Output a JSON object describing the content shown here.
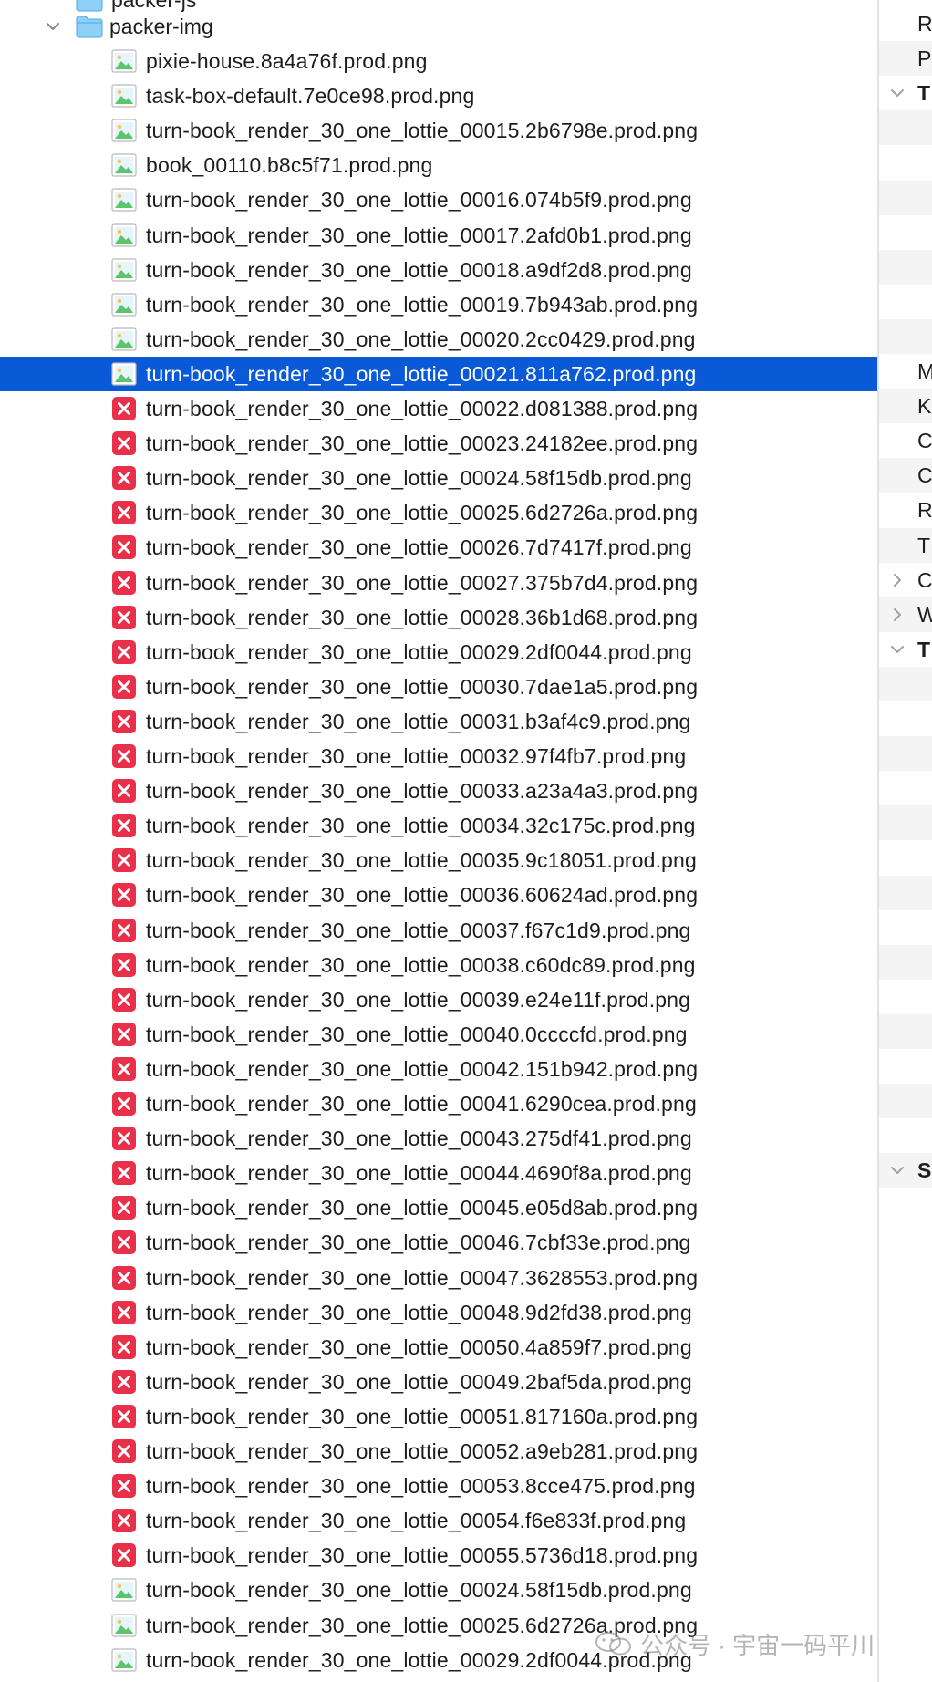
{
  "tree": {
    "parent_label_partial": "packer-js",
    "folder": {
      "name": "packer-img",
      "expanded": true,
      "icon": "folder-icon"
    },
    "selected_index": 9,
    "files": [
      {
        "name": "pixie-house.8a4a76f.prod.png",
        "icon": "image-file-icon"
      },
      {
        "name": "task-box-default.7e0ce98.prod.png",
        "icon": "image-file-icon"
      },
      {
        "name": "turn-book_render_30_one_lottie_00015.2b6798e.prod.png",
        "icon": "image-file-icon"
      },
      {
        "name": "book_00110.b8c5f71.prod.png",
        "icon": "image-file-icon"
      },
      {
        "name": "turn-book_render_30_one_lottie_00016.074b5f9.prod.png",
        "icon": "image-file-icon"
      },
      {
        "name": "turn-book_render_30_one_lottie_00017.2afd0b1.prod.png",
        "icon": "image-file-icon"
      },
      {
        "name": "turn-book_render_30_one_lottie_00018.a9df2d8.prod.png",
        "icon": "image-file-icon"
      },
      {
        "name": "turn-book_render_30_one_lottie_00019.7b943ab.prod.png",
        "icon": "image-file-icon"
      },
      {
        "name": "turn-book_render_30_one_lottie_00020.2cc0429.prod.png",
        "icon": "image-file-icon"
      },
      {
        "name": "turn-book_render_30_one_lottie_00021.811a762.prod.png",
        "icon": "image-file-icon"
      },
      {
        "name": "turn-book_render_30_one_lottie_00022.d081388.prod.png",
        "icon": "missing-file-icon"
      },
      {
        "name": "turn-book_render_30_one_lottie_00023.24182ee.prod.png",
        "icon": "missing-file-icon"
      },
      {
        "name": "turn-book_render_30_one_lottie_00024.58f15db.prod.png",
        "icon": "missing-file-icon"
      },
      {
        "name": "turn-book_render_30_one_lottie_00025.6d2726a.prod.png",
        "icon": "missing-file-icon"
      },
      {
        "name": "turn-book_render_30_one_lottie_00026.7d7417f.prod.png",
        "icon": "missing-file-icon"
      },
      {
        "name": "turn-book_render_30_one_lottie_00027.375b7d4.prod.png",
        "icon": "missing-file-icon"
      },
      {
        "name": "turn-book_render_30_one_lottie_00028.36b1d68.prod.png",
        "icon": "missing-file-icon"
      },
      {
        "name": "turn-book_render_30_one_lottie_00029.2df0044.prod.png",
        "icon": "missing-file-icon"
      },
      {
        "name": "turn-book_render_30_one_lottie_00030.7dae1a5.prod.png",
        "icon": "missing-file-icon"
      },
      {
        "name": "turn-book_render_30_one_lottie_00031.b3af4c9.prod.png",
        "icon": "missing-file-icon"
      },
      {
        "name": "turn-book_render_30_one_lottie_00032.97f4fb7.prod.png",
        "icon": "missing-file-icon"
      },
      {
        "name": "turn-book_render_30_one_lottie_00033.a23a4a3.prod.png",
        "icon": "missing-file-icon"
      },
      {
        "name": "turn-book_render_30_one_lottie_00034.32c175c.prod.png",
        "icon": "missing-file-icon"
      },
      {
        "name": "turn-book_render_30_one_lottie_00035.9c18051.prod.png",
        "icon": "missing-file-icon"
      },
      {
        "name": "turn-book_render_30_one_lottie_00036.60624ad.prod.png",
        "icon": "missing-file-icon"
      },
      {
        "name": "turn-book_render_30_one_lottie_00037.f67c1d9.prod.png",
        "icon": "missing-file-icon"
      },
      {
        "name": "turn-book_render_30_one_lottie_00038.c60dc89.prod.png",
        "icon": "missing-file-icon"
      },
      {
        "name": "turn-book_render_30_one_lottie_00039.e24e11f.prod.png",
        "icon": "missing-file-icon"
      },
      {
        "name": "turn-book_render_30_one_lottie_00040.0ccccfd.prod.png",
        "icon": "missing-file-icon"
      },
      {
        "name": "turn-book_render_30_one_lottie_00042.151b942.prod.png",
        "icon": "missing-file-icon"
      },
      {
        "name": "turn-book_render_30_one_lottie_00041.6290cea.prod.png",
        "icon": "missing-file-icon"
      },
      {
        "name": "turn-book_render_30_one_lottie_00043.275df41.prod.png",
        "icon": "missing-file-icon"
      },
      {
        "name": "turn-book_render_30_one_lottie_00044.4690f8a.prod.png",
        "icon": "missing-file-icon"
      },
      {
        "name": "turn-book_render_30_one_lottie_00045.e05d8ab.prod.png",
        "icon": "missing-file-icon"
      },
      {
        "name": "turn-book_render_30_one_lottie_00046.7cbf33e.prod.png",
        "icon": "missing-file-icon"
      },
      {
        "name": "turn-book_render_30_one_lottie_00047.3628553.prod.png",
        "icon": "missing-file-icon"
      },
      {
        "name": "turn-book_render_30_one_lottie_00048.9d2fd38.prod.png",
        "icon": "missing-file-icon"
      },
      {
        "name": "turn-book_render_30_one_lottie_00050.4a859f7.prod.png",
        "icon": "missing-file-icon"
      },
      {
        "name": "turn-book_render_30_one_lottie_00049.2baf5da.prod.png",
        "icon": "missing-file-icon"
      },
      {
        "name": "turn-book_render_30_one_lottie_00051.817160a.prod.png",
        "icon": "missing-file-icon"
      },
      {
        "name": "turn-book_render_30_one_lottie_00052.a9eb281.prod.png",
        "icon": "missing-file-icon"
      },
      {
        "name": "turn-book_render_30_one_lottie_00053.8cce475.prod.png",
        "icon": "missing-file-icon"
      },
      {
        "name": "turn-book_render_30_one_lottie_00054.f6e833f.prod.png",
        "icon": "missing-file-icon"
      },
      {
        "name": "turn-book_render_30_one_lottie_00055.5736d18.prod.png",
        "icon": "missing-file-icon"
      },
      {
        "name": "turn-book_render_30_one_lottie_00024.58f15db.prod.png",
        "icon": "image-file-icon"
      },
      {
        "name": "turn-book_render_30_one_lottie_00025.6d2726a.prod.png",
        "icon": "image-file-icon"
      },
      {
        "name": "turn-book_render_30_one_lottie_00029.2df0044.prod.png",
        "icon": "image-file-icon"
      }
    ]
  },
  "inspector": {
    "rows": [
      {
        "label": "R",
        "bold": false,
        "chevron": ""
      },
      {
        "label": "P",
        "bold": false,
        "chevron": ""
      },
      {
        "label": "T",
        "bold": true,
        "chevron": "down"
      },
      {
        "label": "",
        "bold": false,
        "chevron": ""
      },
      {
        "label": "",
        "bold": false,
        "chevron": ""
      },
      {
        "label": "",
        "bold": false,
        "chevron": ""
      },
      {
        "label": "",
        "bold": false,
        "chevron": ""
      },
      {
        "label": "",
        "bold": false,
        "chevron": ""
      },
      {
        "label": "",
        "bold": false,
        "chevron": ""
      },
      {
        "label": "",
        "bold": false,
        "chevron": ""
      },
      {
        "label": "M",
        "bold": false,
        "chevron": ""
      },
      {
        "label": "K",
        "bold": false,
        "chevron": ""
      },
      {
        "label": "C",
        "bold": false,
        "chevron": ""
      },
      {
        "label": "C",
        "bold": false,
        "chevron": ""
      },
      {
        "label": "R",
        "bold": false,
        "chevron": ""
      },
      {
        "label": "T",
        "bold": false,
        "chevron": ""
      },
      {
        "label": "C",
        "bold": false,
        "chevron": "right"
      },
      {
        "label": "W",
        "bold": false,
        "chevron": "right"
      },
      {
        "label": "T",
        "bold": true,
        "chevron": "down"
      },
      {
        "label": "",
        "bold": false,
        "chevron": ""
      },
      {
        "label": "",
        "bold": false,
        "chevron": ""
      },
      {
        "label": "",
        "bold": false,
        "chevron": ""
      },
      {
        "label": "",
        "bold": false,
        "chevron": ""
      },
      {
        "label": "",
        "bold": false,
        "chevron": ""
      },
      {
        "label": "",
        "bold": false,
        "chevron": ""
      },
      {
        "label": "",
        "bold": false,
        "chevron": ""
      },
      {
        "label": "",
        "bold": false,
        "chevron": ""
      },
      {
        "label": "",
        "bold": false,
        "chevron": ""
      },
      {
        "label": "",
        "bold": false,
        "chevron": ""
      },
      {
        "label": "",
        "bold": false,
        "chevron": ""
      },
      {
        "label": "",
        "bold": false,
        "chevron": ""
      },
      {
        "label": "",
        "bold": false,
        "chevron": ""
      },
      {
        "label": "",
        "bold": false,
        "chevron": ""
      },
      {
        "label": "S",
        "bold": true,
        "chevron": "down"
      }
    ]
  },
  "watermark": {
    "text": "公众号 · 宇宙一码平川",
    "icon": "wechat-logo-icon"
  },
  "colors": {
    "selection": "#0a5ad8",
    "missing_file_red": "#e8304a",
    "folder_blue": "#5bb8f2",
    "image_icon_green": "#5cc46b"
  }
}
